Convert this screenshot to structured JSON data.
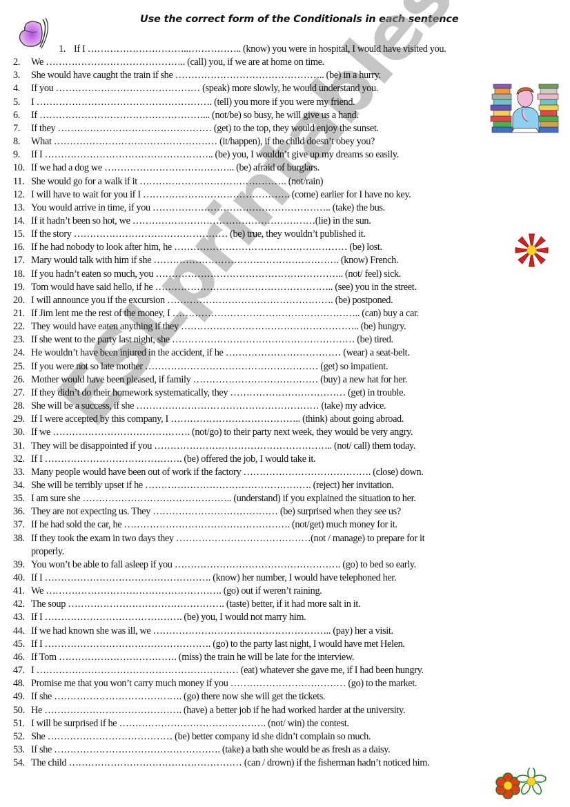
{
  "title": "Use the correct form of the Conditionals in each sentence",
  "watermark": "ESLprintables.com",
  "images": {
    "top_left": "butterfly-icon",
    "top_right": "student-with-books-icon",
    "right_middle": "red-flower-icon",
    "bottom_right": "daisies-icon"
  },
  "sentences": [
    {
      "num": "1.",
      "text": "If I …………………………..…………….. (know) you were in hospital, I would have visited you."
    },
    {
      "num": "2.",
      "text": "We …………………………………….. (call) you, if we are at home on time."
    },
    {
      "num": "3.",
      "text": "She would have caught the train if she ……………………………………….. (be) in a hurry."
    },
    {
      "num": "4.",
      "text": "If you ……………………………………… (speak) more slowly, he would understand you."
    },
    {
      "num": "5.",
      "text": "I ………………………………………………. (tell) you more if you were my friend."
    },
    {
      "num": "6.",
      "text": "If ……………………………………………... (not/be) so busy, he will give us a hand."
    },
    {
      "num": "7.",
      "text": "If they ………………………………………… (get) to the top, they would enjoy the sunset."
    },
    {
      "num": "8.",
      "text": "What …………………………………………… (it/happen), if the child doesn’t obey you?"
    },
    {
      "num": "9.",
      "text": "If I …………………………………………….. (be) you, I wouldn’t give up my dreams so easily."
    },
    {
      "num": "10.",
      "text": "If we had a dog we ………………………………….. (be) afraid of burglars."
    },
    {
      "num": "11.",
      "text": "She would go for a walk if it ………………………………………. (not/rain)"
    },
    {
      "num": "12.",
      "text": "I will have to wait for you if I ………………………………………. (come) earlier  for I have no key."
    },
    {
      "num": "13.",
      "text": "You would arrive in time, if you ……………………………………………….. (take) the bus."
    },
    {
      "num": "14.",
      "text": "If it hadn’t been so hot, we …………………………………………………(lie) in the sun."
    },
    {
      "num": "15.",
      "text": "If the story ………………………………………… (be) true, they wouldn’t published it."
    },
    {
      "num": "16.",
      "text": "If he had nobody to look after him, he ……………………………………………… (be) lost."
    },
    {
      "num": "17.",
      "text": "Mary would talk with him if she …………………………………………………. (know) French."
    },
    {
      "num": "18.",
      "text": "If you hadn’t eaten so much, you ………………………………………………….. (not/ feel) sick."
    },
    {
      "num": "19.",
      "text": "Tom would have said hello, if he ……………………………………………….. (see) you in the street."
    },
    {
      "num": "20.",
      "text": "I will announce you if the excursion ……………………………………………. (be) postponed."
    },
    {
      "num": "21.",
      "text": "If Jim lent me the rest of the money, I ………………………………………………….. (can) buy a car."
    },
    {
      "num": "22.",
      "text": "They would have eaten anything if they ……………………………………………….. (be) hungry."
    },
    {
      "num": "23.",
      "text": "If she went to the party last night, she ………………………………………………… (be) tired."
    },
    {
      "num": "24.",
      "text": "He wouldn’t have been injured in the accident, if he ……………………………… (wear) a seat-belt."
    },
    {
      "num": "25.",
      "text": "If you were not so late mother ……………………………………………… (get) so impatient."
    },
    {
      "num": "26.",
      "text": "Mother would have been pleased, if family ………………………………… (buy) a new  hat for her."
    },
    {
      "num": "27.",
      "text": "If they didn’t do their homework systematically, they ……………………………… (get) in trouble."
    },
    {
      "num": "28.",
      "text": "She will be a success, if she ………………………………………………… (take) my advice."
    },
    {
      "num": "29.",
      "text": "If I were accepted by this company, I ………………………………….. (think) about going  abroad."
    },
    {
      "num": "30.",
      "text": "If we ……………………………………. (not/go) to their party next week, they would be very angry."
    },
    {
      "num": "31.",
      "text": "They will be disappointed if you ……………………………………………….. (not/ call) them today."
    },
    {
      "num": "32.",
      "text": "If I ……………………………………. (be) offered the job, I would take it."
    },
    {
      "num": "33.",
      "text": "Many people would have been out of work if the factory …………………………………. (close) down."
    },
    {
      "num": "34.",
      "text": "She will be terribly upset if he ……………………………………………. (reject) her invitation."
    },
    {
      "num": "35.",
      "text": "I am sure she ……………………………………….. (understand) if you explained the situation to her."
    },
    {
      "num": "36.",
      "text": "They are not expecting us. They ………………………………… (be) surprised when they see us?"
    },
    {
      "num": "37.",
      "text": "If he had sold the car, he ……………………………………………. (not/get) much money for it."
    },
    {
      "num": "38.",
      "text": "If they took the exam in two days they ……………………………………(not / manage) to prepare for it",
      "continuation": "properly."
    },
    {
      "num": "39.",
      "text": "You won’t be able to fall asleep if you ……………………………………………. (go) to bed so early."
    },
    {
      "num": "40.",
      "text": "If I ……………………………………………. (know) her number, I would have telephoned her."
    },
    {
      "num": "41.",
      "text": "We ………………………………………………. (go) out if weren’t raining."
    },
    {
      "num": "42.",
      "text": "The soup …………………………………………. (taste) better, if it had more salt in it."
    },
    {
      "num": "43.",
      "text": "If I ……………………………………. (be) you, I would not marry him."
    },
    {
      "num": "44.",
      "text": "If we had known she was ill, we ……………………………………………….. (pay) her a visit."
    },
    {
      "num": "45.",
      "text": "If I ……………………………………………. (go) to the party last night, I would have met Helen."
    },
    {
      "num": "46.",
      "text": "If Tom ………………………………. (miss) the train he will be late for the interview."
    },
    {
      "num": "47.",
      "text": "I ……………………………………………………… (eat) whatever she gave me, if I had been hungry."
    },
    {
      "num": "48.",
      "text": "Promise me that you won’t carry much money if you ……………………………… (go) to the market."
    },
    {
      "num": "49.",
      "text": "If she …………………………………. (go) there now she will get the tickets."
    },
    {
      "num": "50.",
      "text": "He ……………………………………. (have) a better job if he had worked harder at the university."
    },
    {
      "num": "51.",
      "text": "I will be surprised if he ………………………………………. (not/ win) the contest."
    },
    {
      "num": "52.",
      "text": "She ………………………………… (be) better company id she didn’t complain so much."
    },
    {
      "num": "53.",
      "text": "If she ……………………………………………. (take) a bath she would be as fresh as a daisy."
    },
    {
      "num": "54.",
      "text": "The child ……………………………………………… (can / drown) if the fisherman hadn’t noticed him."
    }
  ]
}
